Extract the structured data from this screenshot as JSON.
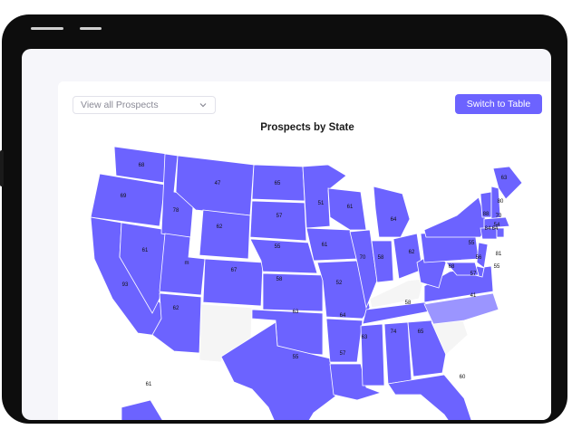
{
  "select": {
    "label": "View all Prospects"
  },
  "switch_button": {
    "label": "Switch to Table"
  },
  "map": {
    "title": "Prospects by State",
    "colors": {
      "filled": "#6c63ff",
      "light": "#9b95ff",
      "empty": "#f5f5f5",
      "border": "#ffffff"
    }
  },
  "chart_data": {
    "type": "choropleth",
    "title": "Prospects by State",
    "labels": [
      {
        "state": "WA",
        "value": "68"
      },
      {
        "state": "OR",
        "value": "69"
      },
      {
        "state": "ID",
        "value": "78"
      },
      {
        "state": "MT",
        "value": "47"
      },
      {
        "state": "WY",
        "value": "62"
      },
      {
        "state": "ND",
        "value": "65"
      },
      {
        "state": "SD",
        "value": "57"
      },
      {
        "state": "NE",
        "value": "55"
      },
      {
        "state": "KS",
        "value": "58"
      },
      {
        "state": "OK",
        "value": "63"
      },
      {
        "state": "TX",
        "value": "55"
      },
      {
        "state": "NV",
        "value": "61"
      },
      {
        "state": "UT",
        "value": "m"
      },
      {
        "state": "CO",
        "value": "67"
      },
      {
        "state": "CA",
        "value": "93"
      },
      {
        "state": "AZ",
        "value": "62"
      },
      {
        "state": "MN",
        "value": "51"
      },
      {
        "state": "WI",
        "value": "61"
      },
      {
        "state": "MI",
        "value": "64"
      },
      {
        "state": "IA",
        "value": "61"
      },
      {
        "state": "IL",
        "value": "70"
      },
      {
        "state": "IN",
        "value": "58"
      },
      {
        "state": "OH",
        "value": "62"
      },
      {
        "state": "MO",
        "value": "52"
      },
      {
        "state": "AR",
        "value": "64"
      },
      {
        "state": "LA",
        "value": "57"
      },
      {
        "state": "MS",
        "value": "63"
      },
      {
        "state": "AL",
        "value": "74"
      },
      {
        "state": "GA",
        "value": "65"
      },
      {
        "state": "FL",
        "value": "60"
      },
      {
        "state": "TN",
        "value": "58"
      },
      {
        "state": "NC",
        "value": "41"
      },
      {
        "state": "VA",
        "value": "57"
      },
      {
        "state": "WV",
        "value": "68"
      },
      {
        "state": "PA",
        "value": "55"
      },
      {
        "state": "NY",
        "value": "88"
      },
      {
        "state": "ME",
        "value": "63"
      },
      {
        "state": "VT",
        "value": "80"
      },
      {
        "state": "NH",
        "value": "70"
      },
      {
        "state": "MA",
        "value": "54"
      },
      {
        "state": "CT",
        "value": "84"
      },
      {
        "state": "RI",
        "value": "64"
      },
      {
        "state": "NJ",
        "value": "81"
      },
      {
        "state": "DE",
        "value": "55"
      },
      {
        "state": "MD",
        "value": "56"
      },
      {
        "state": "AK",
        "value": "61"
      }
    ]
  }
}
